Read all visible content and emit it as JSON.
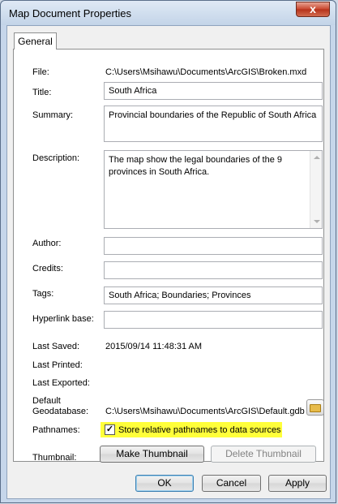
{
  "window": {
    "title": "Map Document Properties",
    "close_label": "x"
  },
  "tab": {
    "label": "General"
  },
  "fields": {
    "file_label": "File:",
    "file_value": "C:\\Users\\Msihawu\\Documents\\ArcGIS\\Broken.mxd",
    "title_label": "Title:",
    "title_value": "South Africa",
    "summary_label": "Summary:",
    "summary_value": "Provincial boundaries of the Republic of South Africa",
    "description_label": "Description:",
    "description_value": "The map show the legal boundaries of the 9 provinces in South Africa.",
    "author_label": "Author:",
    "author_value": "",
    "credits_label": "Credits:",
    "credits_value": "",
    "tags_label": "Tags:",
    "tags_value": "South Africa;  Boundaries;  Provinces",
    "hyperlink_label": "Hyperlink base:",
    "hyperlink_value": "",
    "last_saved_label": "Last Saved:",
    "last_saved_value": "2015/09/14 11:48:31 AM",
    "last_printed_label": "Last Printed:",
    "last_exported_label": "Last Exported:",
    "default_geodatabase_label_1": "Default",
    "default_geodatabase_label_2": "Geodatabase:",
    "default_geodatabase_value": "C:\\Users\\Msihawu\\Documents\\ArcGIS\\Default.gdb",
    "pathnames_label": "Pathnames:",
    "pathnames_checkbox_label": "Store relative pathnames to data sources",
    "pathnames_checked": "✓",
    "thumbnail_label": "Thumbnail:"
  },
  "buttons": {
    "make_thumbnail": "Make Thumbnail",
    "delete_thumbnail": "Delete Thumbnail",
    "ok": "OK",
    "cancel": "Cancel",
    "apply": "Apply"
  },
  "icons": {
    "close": "close-icon",
    "folder": "folder-open-icon",
    "checkbox": "checkbox-checked-icon"
  },
  "colors": {
    "highlight": "#ffff3a",
    "close_button": "#c8452c"
  }
}
